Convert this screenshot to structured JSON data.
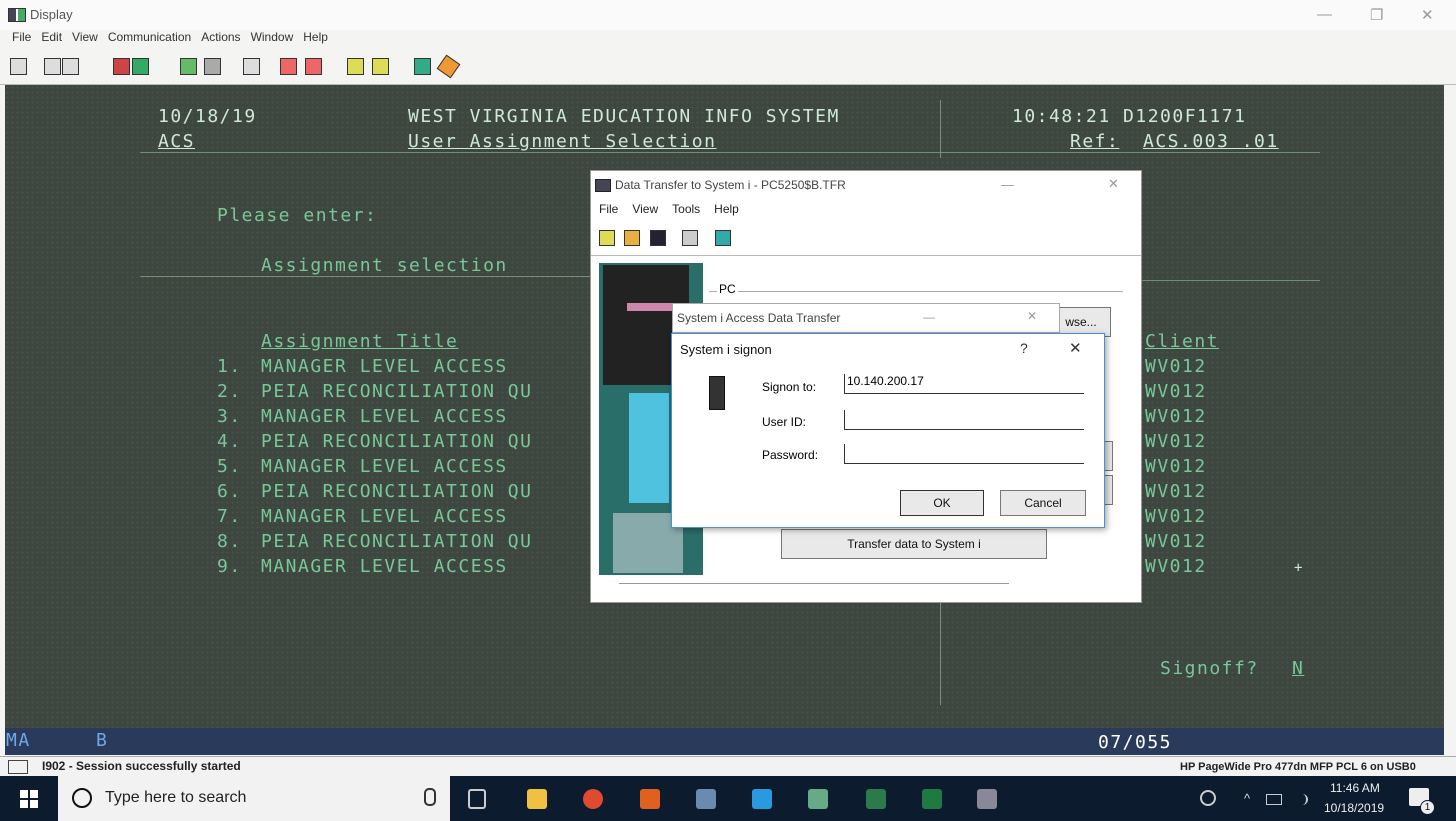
{
  "window": {
    "title": "Display",
    "minimize": "—",
    "maximize": "❐",
    "close": "✕"
  },
  "menu": [
    "File",
    "Edit",
    "View",
    "Communication",
    "Actions",
    "Window",
    "Help"
  ],
  "terminal": {
    "date": "10/18/19",
    "system_title": "WEST VIRGINIA EDUCATION INFO SYSTEM",
    "time_code": "10:48:21 D1200F1171",
    "app_code": "ACS",
    "screen_title": "User Assignment Selection",
    "ref_label": "Ref:",
    "ref_value": "ACS.003 .01",
    "prompt": "Please enter:",
    "field_label": "Assignment selection",
    "col_title": "Assignment Title",
    "col_client": "Client",
    "rows": [
      {
        "num": "1.",
        "title": "MANAGER LEVEL ACCESS",
        "client": "WV012"
      },
      {
        "num": "2.",
        "title": "PEIA RECONCILIATION QU",
        "client": "WV012"
      },
      {
        "num": "3.",
        "title": "MANAGER LEVEL ACCESS",
        "client": "WV012"
      },
      {
        "num": "4.",
        "title": "PEIA RECONCILIATION QU",
        "client": "WV012"
      },
      {
        "num": "5.",
        "title": "MANAGER LEVEL ACCESS",
        "client": "WV012"
      },
      {
        "num": "6.",
        "title": "PEIA RECONCILIATION QU",
        "client": "WV012"
      },
      {
        "num": "7.",
        "title": "MANAGER LEVEL ACCESS",
        "client": "WV012"
      },
      {
        "num": "8.",
        "title": "PEIA RECONCILIATION QU",
        "client": "WV012"
      },
      {
        "num": "9.",
        "title": "MANAGER LEVEL ACCESS",
        "client": "WV012"
      }
    ],
    "signoff_label": "Signoff?",
    "signoff_value": "N",
    "cursor_mark": "+",
    "status_mode": "MA",
    "status_b": "B",
    "status_pos": "07/055"
  },
  "message_bar": {
    "text": "I902 - Session successfully started",
    "printer": "HP PageWide Pro 477dn MFP PCL 6 on USB0"
  },
  "data_transfer": {
    "title": "Data Transfer to System i - PC5250$B.TFR",
    "menu": [
      "File",
      "View",
      "Tools",
      "Help"
    ],
    "group_label": "PC",
    "browse_label": "wse...",
    "transfer_button": "Transfer data to System i",
    "minimize": "—",
    "close": "✕"
  },
  "access_dialog": {
    "title": "System i Access Data Transfer",
    "minimize": "—",
    "close": "✕"
  },
  "signon": {
    "title": "System i signon",
    "help": "?",
    "close": "✕",
    "signon_to_label": "Signon to:",
    "signon_to_value": "10.140.200.17",
    "userid_label": "User ID:",
    "userid_value": "",
    "password_label": "Password:",
    "password_value": "",
    "ok": "OK",
    "cancel": "Cancel"
  },
  "taskbar": {
    "search_placeholder": "Type here to search",
    "time": "11:46 AM",
    "date": "10/18/2019",
    "tray_chevron": "^",
    "notify_count": "1"
  },
  "colors": {
    "terminal_bg": "#3e4640",
    "terminal_text": "#cfe9d8",
    "terminal_green": "#78c898",
    "taskbar": "#0c1b2e"
  }
}
